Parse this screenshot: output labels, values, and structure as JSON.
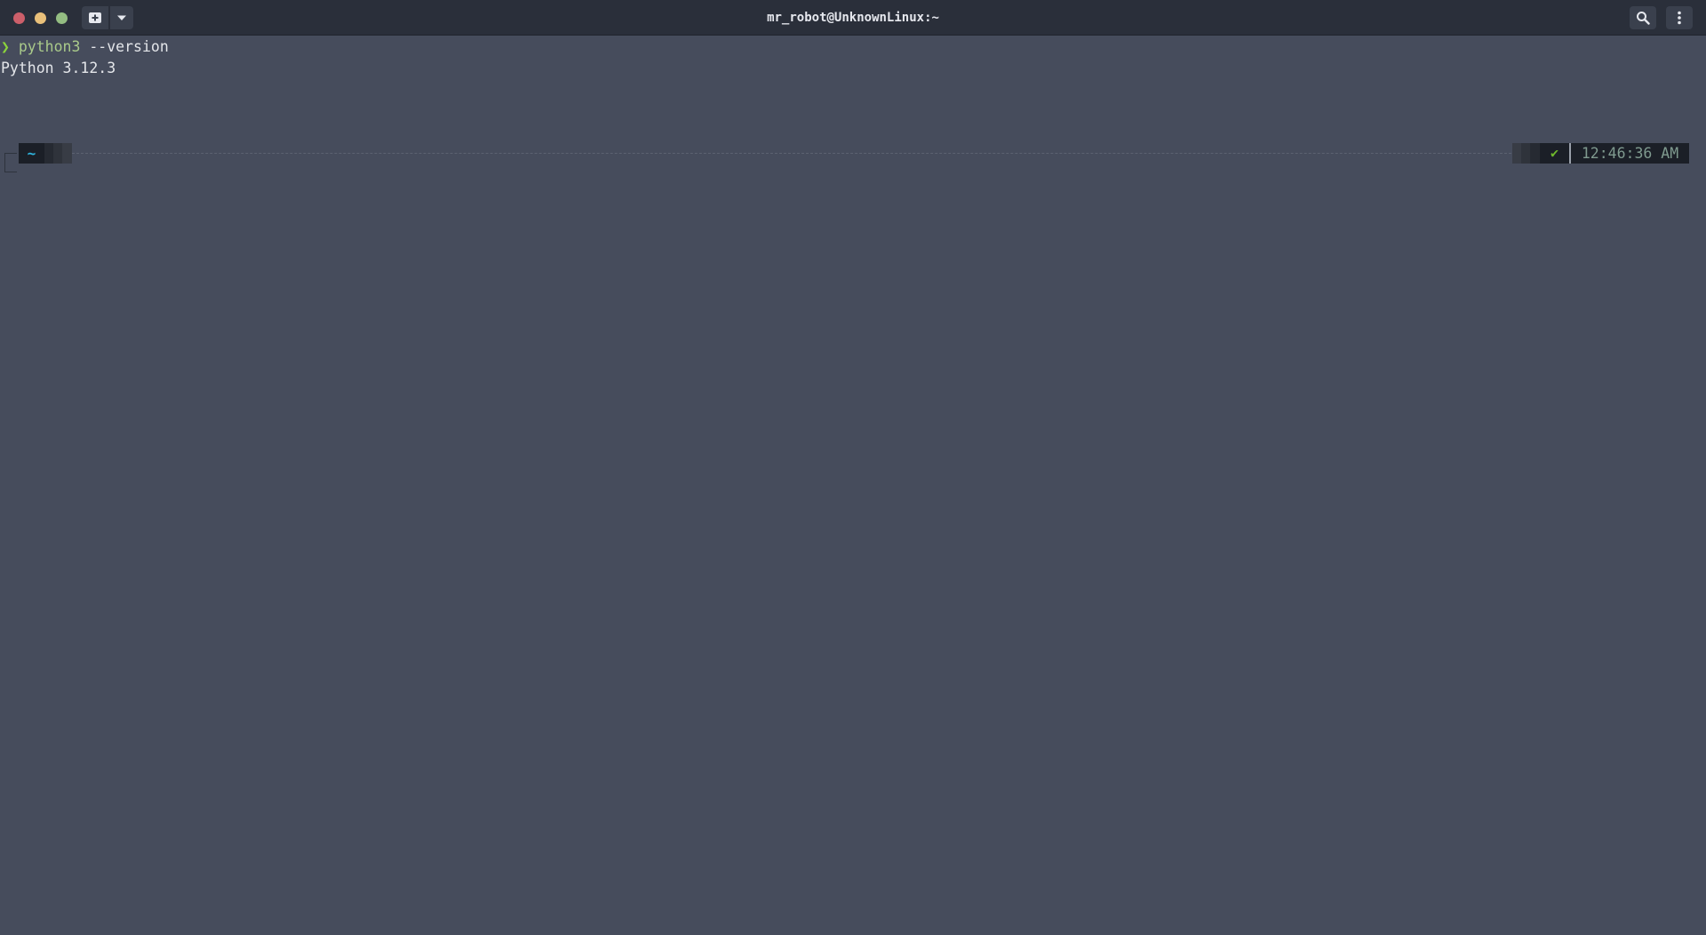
{
  "window": {
    "title": "mr_robot@UnknownLinux:~"
  },
  "titlebar": {
    "buttons": {
      "close": "close-icon",
      "minimize": "minimize-icon",
      "maximize": "maximize-icon",
      "new_tab": "new-tab-icon",
      "tab_dropdown": "chevron-down-icon",
      "search": "search-icon",
      "menu": "kebab-menu-icon"
    }
  },
  "terminal": {
    "lines": [
      {
        "prompt": "❯",
        "command": "python3",
        "args": " --version"
      },
      {
        "output": "Python 3.12.3"
      }
    ],
    "powerline": {
      "directory": "~",
      "status": "✔",
      "time": "12:46:36 AM"
    }
  },
  "colors": {
    "background": "#464c5c",
    "titlebar": "#2a2f3a",
    "prompt_char": "#8bd33c",
    "command": "#a9c98a",
    "directory": "#2fb6e0",
    "status_ok": "#6fb82c",
    "time": "#7f9a8f"
  }
}
